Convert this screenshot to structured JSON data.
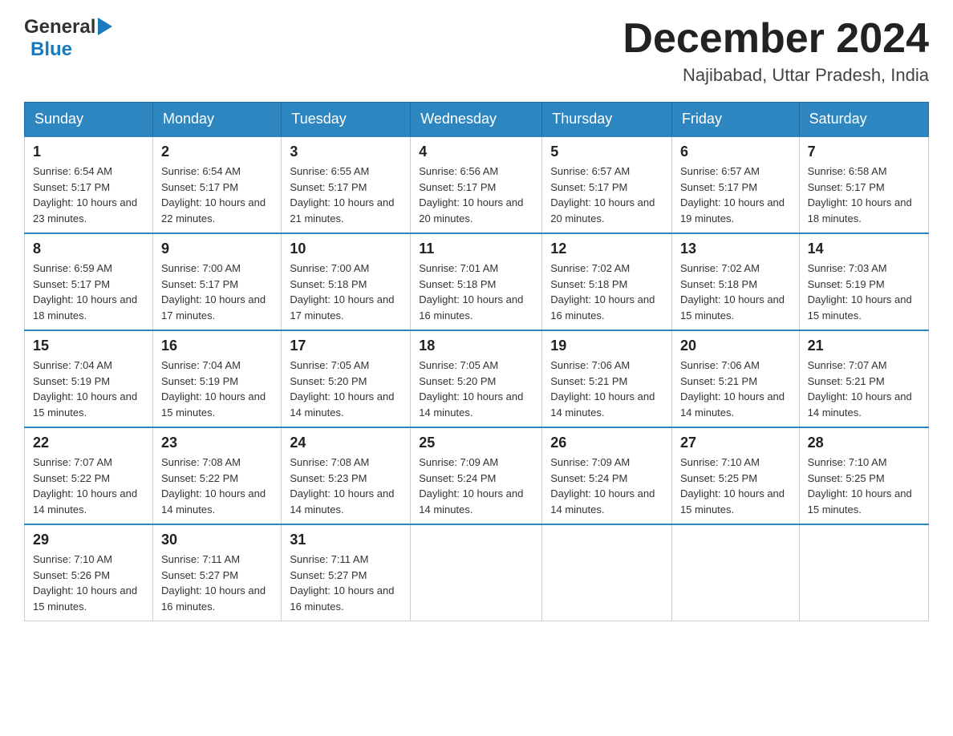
{
  "header": {
    "logo_general": "General",
    "logo_blue": "Blue",
    "month_title": "December 2024",
    "location": "Najibabad, Uttar Pradesh, India"
  },
  "days_of_week": [
    "Sunday",
    "Monday",
    "Tuesday",
    "Wednesday",
    "Thursday",
    "Friday",
    "Saturday"
  ],
  "weeks": [
    [
      {
        "day": "1",
        "sunrise": "Sunrise: 6:54 AM",
        "sunset": "Sunset: 5:17 PM",
        "daylight": "Daylight: 10 hours and 23 minutes."
      },
      {
        "day": "2",
        "sunrise": "Sunrise: 6:54 AM",
        "sunset": "Sunset: 5:17 PM",
        "daylight": "Daylight: 10 hours and 22 minutes."
      },
      {
        "day": "3",
        "sunrise": "Sunrise: 6:55 AM",
        "sunset": "Sunset: 5:17 PM",
        "daylight": "Daylight: 10 hours and 21 minutes."
      },
      {
        "day": "4",
        "sunrise": "Sunrise: 6:56 AM",
        "sunset": "Sunset: 5:17 PM",
        "daylight": "Daylight: 10 hours and 20 minutes."
      },
      {
        "day": "5",
        "sunrise": "Sunrise: 6:57 AM",
        "sunset": "Sunset: 5:17 PM",
        "daylight": "Daylight: 10 hours and 20 minutes."
      },
      {
        "day": "6",
        "sunrise": "Sunrise: 6:57 AM",
        "sunset": "Sunset: 5:17 PM",
        "daylight": "Daylight: 10 hours and 19 minutes."
      },
      {
        "day": "7",
        "sunrise": "Sunrise: 6:58 AM",
        "sunset": "Sunset: 5:17 PM",
        "daylight": "Daylight: 10 hours and 18 minutes."
      }
    ],
    [
      {
        "day": "8",
        "sunrise": "Sunrise: 6:59 AM",
        "sunset": "Sunset: 5:17 PM",
        "daylight": "Daylight: 10 hours and 18 minutes."
      },
      {
        "day": "9",
        "sunrise": "Sunrise: 7:00 AM",
        "sunset": "Sunset: 5:17 PM",
        "daylight": "Daylight: 10 hours and 17 minutes."
      },
      {
        "day": "10",
        "sunrise": "Sunrise: 7:00 AM",
        "sunset": "Sunset: 5:18 PM",
        "daylight": "Daylight: 10 hours and 17 minutes."
      },
      {
        "day": "11",
        "sunrise": "Sunrise: 7:01 AM",
        "sunset": "Sunset: 5:18 PM",
        "daylight": "Daylight: 10 hours and 16 minutes."
      },
      {
        "day": "12",
        "sunrise": "Sunrise: 7:02 AM",
        "sunset": "Sunset: 5:18 PM",
        "daylight": "Daylight: 10 hours and 16 minutes."
      },
      {
        "day": "13",
        "sunrise": "Sunrise: 7:02 AM",
        "sunset": "Sunset: 5:18 PM",
        "daylight": "Daylight: 10 hours and 15 minutes."
      },
      {
        "day": "14",
        "sunrise": "Sunrise: 7:03 AM",
        "sunset": "Sunset: 5:19 PM",
        "daylight": "Daylight: 10 hours and 15 minutes."
      }
    ],
    [
      {
        "day": "15",
        "sunrise": "Sunrise: 7:04 AM",
        "sunset": "Sunset: 5:19 PM",
        "daylight": "Daylight: 10 hours and 15 minutes."
      },
      {
        "day": "16",
        "sunrise": "Sunrise: 7:04 AM",
        "sunset": "Sunset: 5:19 PM",
        "daylight": "Daylight: 10 hours and 15 minutes."
      },
      {
        "day": "17",
        "sunrise": "Sunrise: 7:05 AM",
        "sunset": "Sunset: 5:20 PM",
        "daylight": "Daylight: 10 hours and 14 minutes."
      },
      {
        "day": "18",
        "sunrise": "Sunrise: 7:05 AM",
        "sunset": "Sunset: 5:20 PM",
        "daylight": "Daylight: 10 hours and 14 minutes."
      },
      {
        "day": "19",
        "sunrise": "Sunrise: 7:06 AM",
        "sunset": "Sunset: 5:21 PM",
        "daylight": "Daylight: 10 hours and 14 minutes."
      },
      {
        "day": "20",
        "sunrise": "Sunrise: 7:06 AM",
        "sunset": "Sunset: 5:21 PM",
        "daylight": "Daylight: 10 hours and 14 minutes."
      },
      {
        "day": "21",
        "sunrise": "Sunrise: 7:07 AM",
        "sunset": "Sunset: 5:21 PM",
        "daylight": "Daylight: 10 hours and 14 minutes."
      }
    ],
    [
      {
        "day": "22",
        "sunrise": "Sunrise: 7:07 AM",
        "sunset": "Sunset: 5:22 PM",
        "daylight": "Daylight: 10 hours and 14 minutes."
      },
      {
        "day": "23",
        "sunrise": "Sunrise: 7:08 AM",
        "sunset": "Sunset: 5:22 PM",
        "daylight": "Daylight: 10 hours and 14 minutes."
      },
      {
        "day": "24",
        "sunrise": "Sunrise: 7:08 AM",
        "sunset": "Sunset: 5:23 PM",
        "daylight": "Daylight: 10 hours and 14 minutes."
      },
      {
        "day": "25",
        "sunrise": "Sunrise: 7:09 AM",
        "sunset": "Sunset: 5:24 PM",
        "daylight": "Daylight: 10 hours and 14 minutes."
      },
      {
        "day": "26",
        "sunrise": "Sunrise: 7:09 AM",
        "sunset": "Sunset: 5:24 PM",
        "daylight": "Daylight: 10 hours and 14 minutes."
      },
      {
        "day": "27",
        "sunrise": "Sunrise: 7:10 AM",
        "sunset": "Sunset: 5:25 PM",
        "daylight": "Daylight: 10 hours and 15 minutes."
      },
      {
        "day": "28",
        "sunrise": "Sunrise: 7:10 AM",
        "sunset": "Sunset: 5:25 PM",
        "daylight": "Daylight: 10 hours and 15 minutes."
      }
    ],
    [
      {
        "day": "29",
        "sunrise": "Sunrise: 7:10 AM",
        "sunset": "Sunset: 5:26 PM",
        "daylight": "Daylight: 10 hours and 15 minutes."
      },
      {
        "day": "30",
        "sunrise": "Sunrise: 7:11 AM",
        "sunset": "Sunset: 5:27 PM",
        "daylight": "Daylight: 10 hours and 16 minutes."
      },
      {
        "day": "31",
        "sunrise": "Sunrise: 7:11 AM",
        "sunset": "Sunset: 5:27 PM",
        "daylight": "Daylight: 10 hours and 16 minutes."
      },
      null,
      null,
      null,
      null
    ]
  ]
}
